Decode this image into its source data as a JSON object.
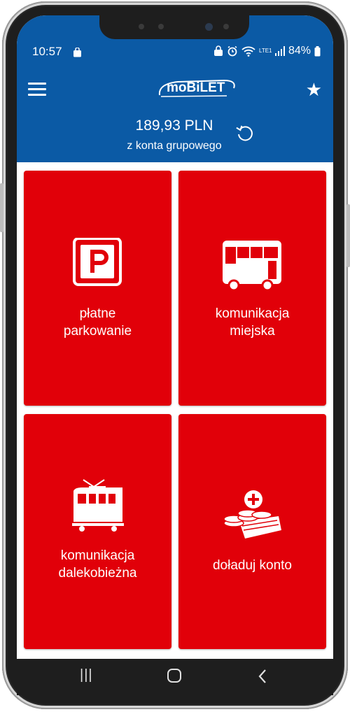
{
  "status": {
    "time": "10:57",
    "battery": "84%",
    "network": "LTE1",
    "icons": [
      "shopping-bag-icon",
      "lock-icon",
      "alarm-icon",
      "wifi-icon",
      "volte-icon",
      "signal-icon",
      "battery-icon"
    ]
  },
  "header": {
    "logo_text": "moBiLET",
    "balance": "189,93 PLN",
    "balance_source": "z konta grupowego",
    "icons": [
      "menu-icon",
      "star-icon",
      "refresh-icon"
    ]
  },
  "tiles": [
    {
      "line1": "płatne",
      "line2": "parkowanie",
      "icon": "parking-icon"
    },
    {
      "line1": "komunikacja",
      "line2": "miejska",
      "icon": "bus-icon"
    },
    {
      "line1": "komunikacja",
      "line2": "dalekobieżna",
      "icon": "train-icon"
    },
    {
      "line1": "doładuj konto",
      "line2": "",
      "icon": "top-up-icon"
    }
  ],
  "nav": {
    "recents": "recents-icon",
    "home": "home-icon",
    "back": "back-icon"
  },
  "colors": {
    "brand_blue": "#0b5aa5",
    "tile_red": "#e10009"
  }
}
